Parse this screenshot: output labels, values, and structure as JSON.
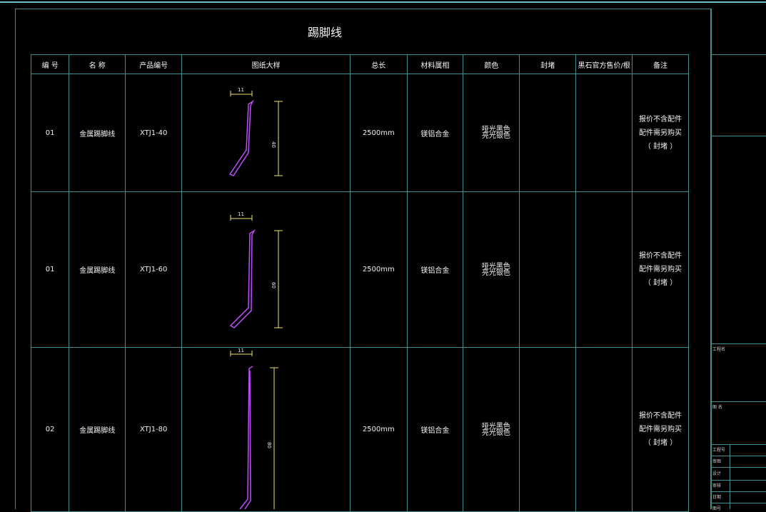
{
  "title": "踢脚线",
  "headers": [
    "编 号",
    "名 称",
    "产品编号",
    "图纸大样",
    "总长",
    "材料属相",
    "颜色",
    "封堵",
    "黑石官方售价/根",
    "备注"
  ],
  "rows": [
    {
      "no": "01",
      "name": "金属踢脚线",
      "code": "XTJ1-40",
      "width": "11",
      "height": "40",
      "length": "2500mm",
      "material": "镁铝合金",
      "color1": "哑光黑色",
      "color2": "亮光银色",
      "seal": "",
      "price": "",
      "remark1": "报价不含配件",
      "remark2": "配件需另购买",
      "remark3": "（ 封堵 ）"
    },
    {
      "no": "01",
      "name": "金属踢脚线",
      "code": "XTJ1-60",
      "width": "11",
      "height": "60",
      "length": "2500mm",
      "material": "镁铝合金",
      "color1": "哑光黑色",
      "color2": "亮光银色",
      "seal": "",
      "price": "",
      "remark1": "报价不含配件",
      "remark2": "配件需另购买",
      "remark3": "（ 封堵 ）"
    },
    {
      "no": "02",
      "name": "金属踢脚线",
      "code": "XTJ1-80",
      "width": "11",
      "height": "80",
      "length": "2500mm",
      "material": "镁铝合金",
      "color1": "哑光黑色",
      "color2": "亮光银色",
      "seal": "",
      "price": "",
      "remark1": "报价不含配件",
      "remark2": "配件需另购买",
      "remark3": "（ 封堵 ）"
    }
  ],
  "title_block": {
    "project_name": "工程名",
    "drawing_name": "图 名",
    "drawing_no": "工程号",
    "field_design_review": "审图",
    "field_design": "设计",
    "field_check": "审核",
    "field_date": "日期",
    "field_scale": "图号"
  },
  "colors": {
    "grid": "#3f8f8f",
    "profile": "#c04cff",
    "dimension": "#f2e36b"
  }
}
